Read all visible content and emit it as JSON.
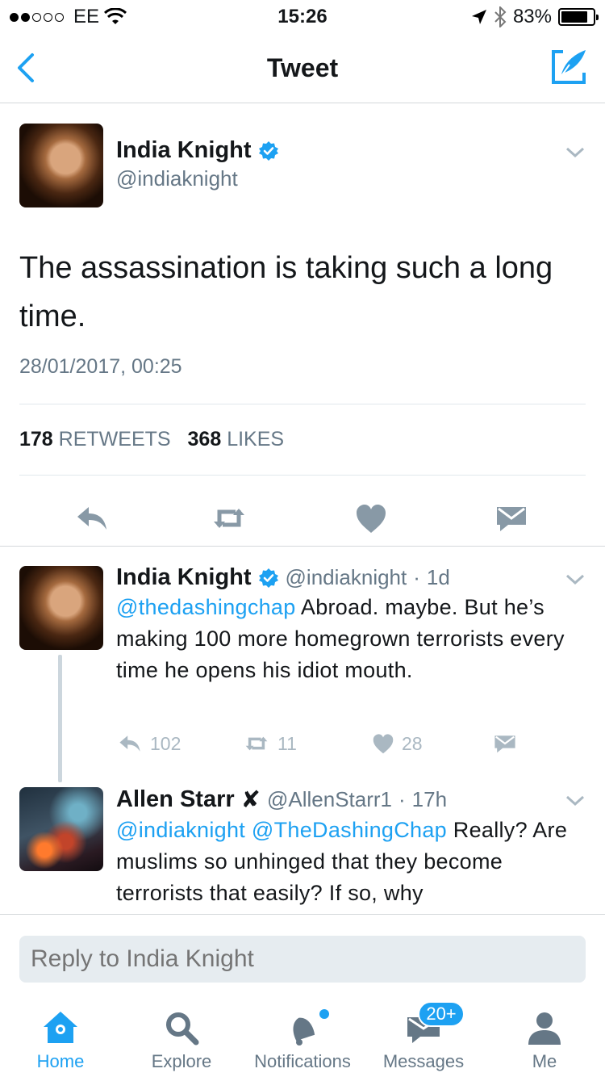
{
  "status_bar": {
    "carrier": "EE",
    "time": "15:26",
    "battery": "83%",
    "battery_level": 0.83
  },
  "nav": {
    "title": "Tweet",
    "back_icon": "chevron-left-icon",
    "compose_icon": "compose-quill-icon"
  },
  "main_tweet": {
    "name": "India Knight",
    "handle": "@indiaknight",
    "text": "The assassination is taking such a long time.",
    "timestamp": "28/01/2017, 00:25",
    "retweets_count": "178",
    "retweets_label": "RETWEETS",
    "likes_count": "368",
    "likes_label": "LIKES",
    "actions": [
      "reply-icon",
      "retweet-icon",
      "heart-icon",
      "envelope-icon"
    ]
  },
  "replies": [
    {
      "name": "India Knight",
      "handle": "@indiaknight",
      "age": "1d",
      "mention": "@thedashingchap",
      "text": "Abroad. maybe. But he’s making 100 more homegrown terrorists every time he opens his idiot mouth.",
      "reply_count": "102",
      "retweet_count": "11",
      "like_count": "28"
    },
    {
      "name": "Allen Starr",
      "name_mark": "✘",
      "handle": "@AllenStarr1",
      "age": "17h",
      "mention1": "@indiaknight",
      "mention2": "@TheDashingChap",
      "text": "Really? Are muslims so unhinged that they become terrorists that easily? If so, why"
    }
  ],
  "reply_box": {
    "placeholder": "Reply to India Knight"
  },
  "tabs": [
    {
      "label": "Home",
      "active": true
    },
    {
      "label": "Explore"
    },
    {
      "label": "Notifications"
    },
    {
      "label": "Messages",
      "badge": "20+"
    },
    {
      "label": "Me"
    }
  ],
  "colors": {
    "accent": "#1da1f2",
    "secondary_text": "#657786",
    "icon_gray": "#8899a6"
  }
}
